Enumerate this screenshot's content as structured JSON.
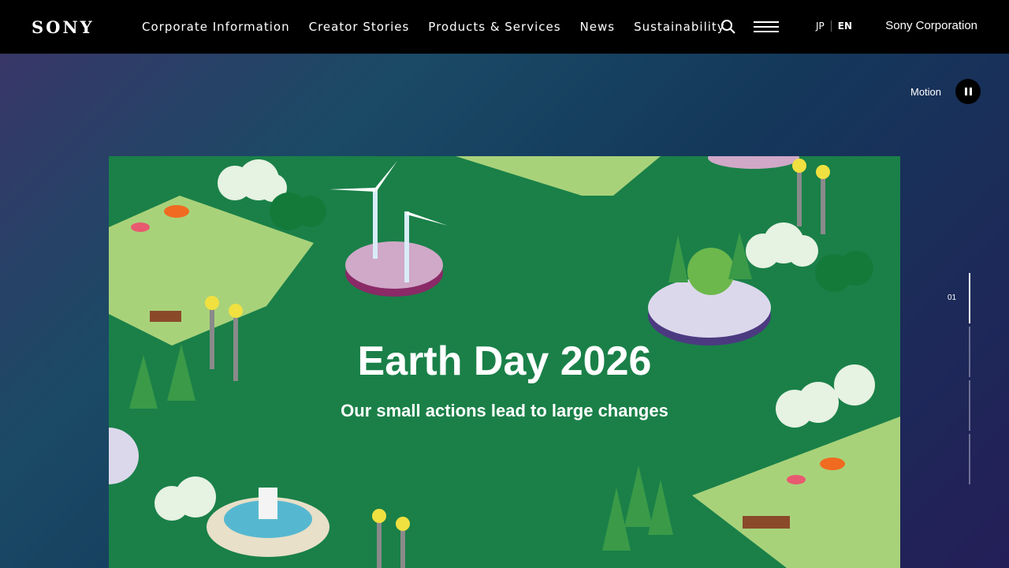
{
  "header": {
    "logo": "SONY",
    "nav": [
      {
        "label": "Corporate Information"
      },
      {
        "label": "Creator Stories"
      },
      {
        "label": "Products & Services"
      },
      {
        "label": "News"
      },
      {
        "label": "Sustainability"
      }
    ],
    "lang_jp": "JP",
    "lang_en": "EN",
    "corporate_link": "Sony Corporation"
  },
  "motion": {
    "label": "Motion"
  },
  "slider": {
    "current": "01",
    "total_indicators": 4
  },
  "hero": {
    "title": "Earth Day 2026",
    "subtitle": "Our small actions lead to large changes"
  },
  "colors": {
    "header_bg": "#000000",
    "hero_green": "#1a8048",
    "light_grass": "#a8d27a",
    "platform": "#d0a8c8"
  },
  "icons": [
    "search-icon",
    "menu-icon",
    "pause-icon"
  ]
}
